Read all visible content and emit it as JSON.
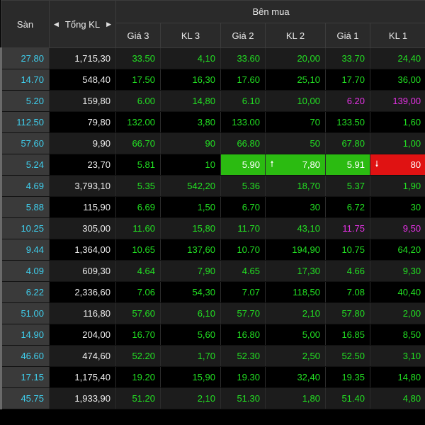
{
  "header": {
    "san": "Sàn",
    "tong_kl": "Tổng KL",
    "ben_mua": "Bên mua",
    "gia3": "Giá 3",
    "kl3": "KL 3",
    "gia2": "Giá 2",
    "kl2": "KL 2",
    "gia1": "Giá 1",
    "kl1": "KL 1"
  },
  "rows": [
    {
      "san": "27.80",
      "tkl": "1,715,30",
      "g3": "33.50",
      "k3": "4,10",
      "g2": "33.60",
      "k2": "20,00",
      "g1": "33.70",
      "k1": "24,40"
    },
    {
      "san": "14.70",
      "tkl": "548,40",
      "g3": "17.50",
      "k3": "16,30",
      "g2": "17.60",
      "k2": "25,10",
      "g1": "17.70",
      "k1": "36,00"
    },
    {
      "san": "5.20",
      "tkl": "159,80",
      "g3": "6.00",
      "k3": "14,80",
      "g2": "6.10",
      "k2": "10,00",
      "g1": "6.20",
      "k1": "139,00"
    },
    {
      "san": "112.50",
      "tkl": "79,80",
      "g3": "132.00",
      "k3": "3,80",
      "g2": "133.00",
      "k2": "70",
      "g1": "133.50",
      "k1": "1,60"
    },
    {
      "san": "57.60",
      "tkl": "9,90",
      "g3": "66.70",
      "k3": "90",
      "g2": "66.80",
      "k2": "50",
      "g1": "67.80",
      "k1": "1,00"
    },
    {
      "san": "5.24",
      "tkl": "23,70",
      "g3": "5.81",
      "k3": "10",
      "g2": "5.90",
      "k2": "7,80",
      "g1": "5.91",
      "k1": "80"
    },
    {
      "san": "4.69",
      "tkl": "3,793,10",
      "g3": "5.35",
      "k3": "542,20",
      "g2": "5.36",
      "k2": "18,70",
      "g1": "5.37",
      "k1": "1,90"
    },
    {
      "san": "5.88",
      "tkl": "115,90",
      "g3": "6.69",
      "k3": "1,50",
      "g2": "6.70",
      "k2": "30",
      "g1": "6.72",
      "k1": "30"
    },
    {
      "san": "10.25",
      "tkl": "305,00",
      "g3": "11.60",
      "k3": "15,80",
      "g2": "11.70",
      "k2": "43,10",
      "g1": "11.75",
      "k1": "9,50"
    },
    {
      "san": "9.44",
      "tkl": "1,364,00",
      "g3": "10.65",
      "k3": "137,60",
      "g2": "10.70",
      "k2": "194,90",
      "g1": "10.75",
      "k1": "64,20"
    },
    {
      "san": "4.09",
      "tkl": "609,30",
      "g3": "4.64",
      "k3": "7,90",
      "g2": "4.65",
      "k2": "17,30",
      "g1": "4.66",
      "k1": "9,30"
    },
    {
      "san": "6.22",
      "tkl": "2,336,60",
      "g3": "7.06",
      "k3": "54,30",
      "g2": "7.07",
      "k2": "118,50",
      "g1": "7.08",
      "k1": "40,40"
    },
    {
      "san": "51.00",
      "tkl": "116,80",
      "g3": "57.60",
      "k3": "6,10",
      "g2": "57.70",
      "k2": "2,10",
      "g1": "57.80",
      "k1": "2,00"
    },
    {
      "san": "14.90",
      "tkl": "204,00",
      "g3": "16.70",
      "k3": "5,60",
      "g2": "16.80",
      "k2": "5,00",
      "g1": "16.85",
      "k1": "8,50"
    },
    {
      "san": "46.60",
      "tkl": "474,60",
      "g3": "52.20",
      "k3": "1,70",
      "g2": "52.30",
      "k2": "2,50",
      "g1": "52.50",
      "k1": "3,10"
    },
    {
      "san": "17.15",
      "tkl": "1,175,40",
      "g3": "19.20",
      "k3": "15,90",
      "g2": "19.30",
      "k2": "32,40",
      "g1": "19.35",
      "k1": "14,80"
    },
    {
      "san": "45.75",
      "tkl": "1,933,90",
      "g3": "51.20",
      "k3": "2,10",
      "g2": "51.30",
      "k2": "1,80",
      "g1": "51.40",
      "k1": "4,80"
    }
  ],
  "colors": {
    "up": "#22e022",
    "ceiling": "#e632e6",
    "floor_text": "#3fd0ef",
    "flash_up": "#2bbb11",
    "flash_down": "#e01212"
  }
}
